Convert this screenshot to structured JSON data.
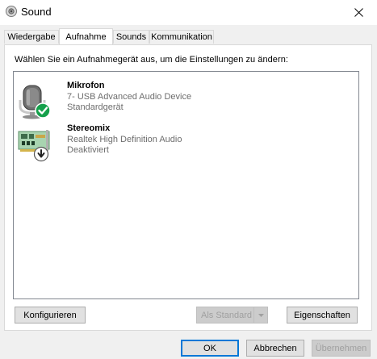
{
  "window": {
    "title": "Sound",
    "icon": "speaker-icon",
    "close": "close-icon"
  },
  "tabs": [
    {
      "label": "Wiedergabe",
      "active": false
    },
    {
      "label": "Aufnahme",
      "active": true
    },
    {
      "label": "Sounds",
      "active": false
    },
    {
      "label": "Kommunikation",
      "active": false
    }
  ],
  "instruction": "Wählen Sie ein Aufnahmegerät aus, um die Einstellungen zu ändern:",
  "devices": [
    {
      "name": "Mikrofon",
      "detail": "7- USB Advanced Audio Device",
      "status": "Standardgerät",
      "icon": "microphone-icon",
      "badge": "default-device-check-icon"
    },
    {
      "name": "Stereomix",
      "detail": "Realtek High Definition Audio",
      "status": "Deaktiviert",
      "icon": "sound-card-icon",
      "badge": "disabled-arrow-icon"
    }
  ],
  "buttons": {
    "configure": "Konfigurieren",
    "set_default": "Als Standard",
    "properties": "Eigenschaften",
    "ok": "OK",
    "cancel": "Abbrechen",
    "apply": "Übernehmen"
  },
  "colors": {
    "accent": "#0078d7",
    "check_green": "#15a04b",
    "list_border": "#828790"
  }
}
